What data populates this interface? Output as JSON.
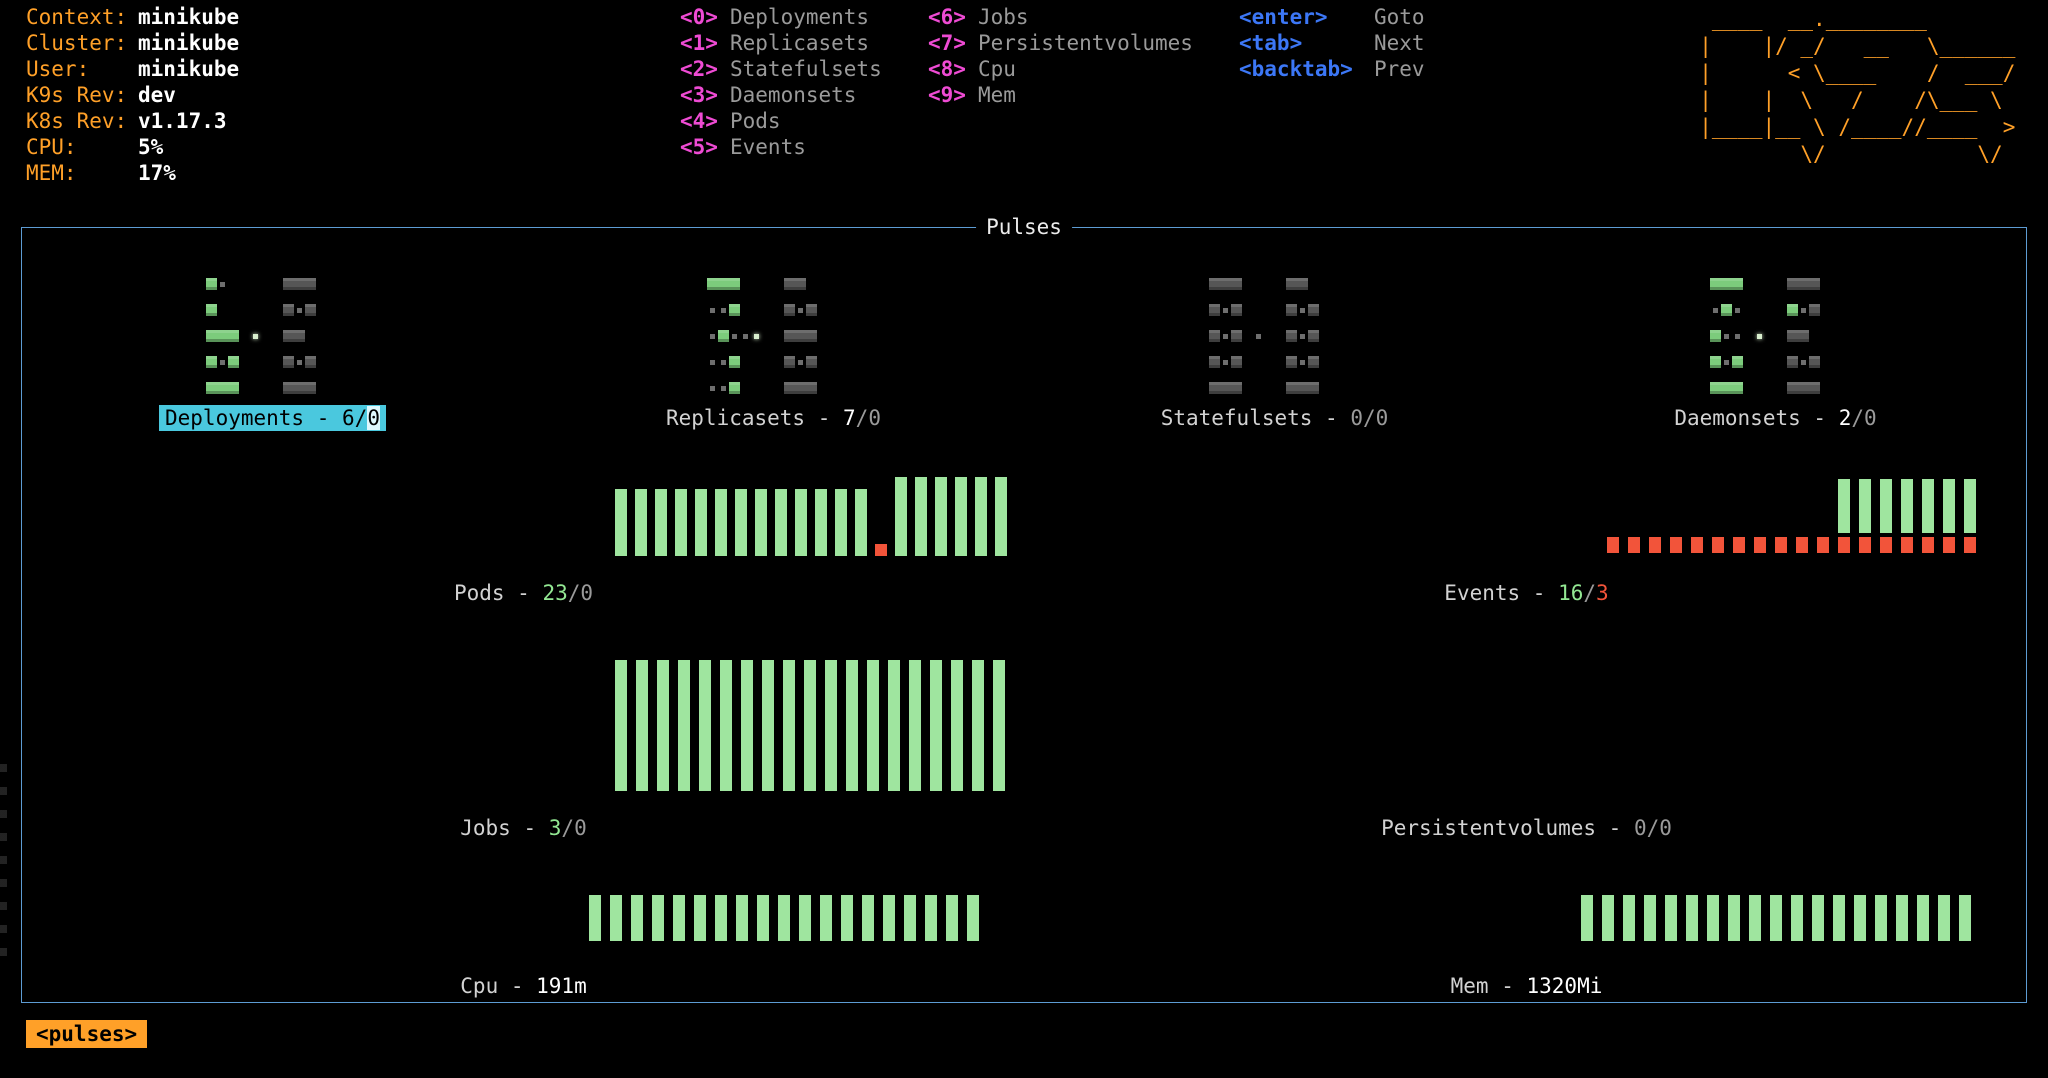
{
  "header": {
    "rows": [
      {
        "label": "Context:",
        "value": "minikube"
      },
      {
        "label": "Cluster:",
        "value": "minikube"
      },
      {
        "label": "User:",
        "value": "minikube"
      },
      {
        "label": "K9s Rev:",
        "value": "dev"
      },
      {
        "label": "K8s Rev:",
        "value": "v1.17.3"
      },
      {
        "label": "CPU:",
        "value": "5%"
      },
      {
        "label": "MEM:",
        "value": "17%"
      }
    ]
  },
  "menu": {
    "col1": [
      {
        "key": "<0>",
        "label": "Deployments"
      },
      {
        "key": "<1>",
        "label": "Replicasets"
      },
      {
        "key": "<2>",
        "label": "Statefulsets"
      },
      {
        "key": "<3>",
        "label": "Daemonsets"
      },
      {
        "key": "<4>",
        "label": "Pods"
      },
      {
        "key": "<5>",
        "label": "Events"
      }
    ],
    "col2": [
      {
        "key": "<6>",
        "label": "Jobs"
      },
      {
        "key": "<7>",
        "label": "Persistentvolumes"
      },
      {
        "key": "<8>",
        "label": "Cpu"
      },
      {
        "key": "<9>",
        "label": "Mem"
      }
    ],
    "col3": [
      {
        "key": "<enter>",
        "label": "Goto"
      },
      {
        "key": "<tab>",
        "label": "Next"
      },
      {
        "key": "<backtab>",
        "label": "Prev"
      }
    ]
  },
  "logo": {
    "lines": [
      " ____  __.________        ",
      "|    |/ _/   __   \\______ ",
      "|      < \\____    /  ___/ ",
      "|    |  \\   /    /\\___ \\  ",
      "|____|__ \\ /____//____  > ",
      "        \\/            \\/  "
    ]
  },
  "pulses": {
    "title": "Pulses",
    "tiles": [
      {
        "id": "deployments",
        "prefix": "Deployments - ",
        "ok": "6",
        "fault": "0",
        "selected": true,
        "pattern": [
          "G.     DDD  ",
          "G      D.D  ",
          "GGG *  DD   ",
          "G.G    D.D  ",
          "GGG    DDD  "
        ]
      },
      {
        "id": "replicasets",
        "prefix": "Replicasets - ",
        "ok": "7",
        "fault": "0",
        "selected": false,
        "pattern": [
          "GGG    DD   ",
          "..G    D.D  ",
          ".G..*  DDD  ",
          "..G    D.D  ",
          "..G    DDD  "
        ]
      },
      {
        "id": "statefulsets",
        "prefix": "Statefulsets - ",
        "ok": "0",
        "fault": "0",
        "selected": false,
        "pattern": [
          "DDD    DD   ",
          "D.D    D.D  ",
          "D.D .  D.D  ",
          "D.D    D.D  ",
          "DDD    DDD  "
        ]
      },
      {
        "id": "daemonsets",
        "prefix": "Daemonsets - ",
        "ok": "2",
        "fault": "0",
        "selected": false,
        "pattern": [
          "GGG    DDD  ",
          ".G.    G.D  ",
          "G.. *  DD   ",
          "G.G    D.D  ",
          "GGG    DDD  "
        ]
      }
    ],
    "charts": [
      {
        "id": "pods",
        "prefix": "Pods - ",
        "ok": "23",
        "fault": "0",
        "bars": [
          "g85",
          "g85",
          "g85",
          "g85",
          "g85",
          "g85",
          "g85",
          "g85",
          "g85",
          "g85",
          "g85",
          "g85",
          "g85",
          "r15",
          "g100",
          "g100",
          "g100",
          "g100",
          "g100",
          "g100"
        ]
      },
      {
        "id": "events",
        "prefix": "Events - ",
        "ok": "16",
        "fault": "3",
        "columns": [
          "d",
          "d",
          "d",
          "d",
          "d",
          "d",
          "d",
          "d",
          "d",
          "d",
          "d",
          "bd",
          "bd",
          "bd",
          "bd",
          "bd",
          "bd",
          "bd"
        ]
      },
      {
        "id": "jobs",
        "prefix": "Jobs - ",
        "ok": "3",
        "fault": "0",
        "bars": [
          "g100",
          "g100",
          "g100",
          "g100",
          "g100",
          "g100",
          "g100",
          "g100",
          "g100",
          "g100",
          "g100",
          "g100",
          "g100",
          "g100",
          "g100",
          "g100",
          "g100",
          "g100",
          "g100"
        ]
      },
      {
        "id": "persistentvolumes",
        "prefix": "Persistentvolumes - ",
        "ok": "0",
        "fault": "0",
        "bars": []
      },
      {
        "id": "cpu",
        "prefix": "Cpu - ",
        "value": "191m",
        "bars": [
          "g100",
          "g100",
          "g100",
          "g100",
          "g100",
          "g100",
          "g100",
          "g100",
          "g100",
          "g100",
          "g100",
          "g100",
          "g100",
          "g100",
          "g100",
          "g100",
          "g100",
          "g100",
          "g100"
        ]
      },
      {
        "id": "mem",
        "prefix": "Mem - ",
        "value": "1320Mi",
        "bars": [
          "g100",
          "g100",
          "g100",
          "g100",
          "g100",
          "g100",
          "g100",
          "g100",
          "g100",
          "g100",
          "g100",
          "g100",
          "g100",
          "g100",
          "g100",
          "g100",
          "g100",
          "g100",
          "g100"
        ]
      }
    ]
  },
  "crumbs": [
    "<pulses>"
  ],
  "colors": {
    "accent_orange": "#ffa028",
    "hotkey_magenta": "#ef4bd4",
    "hotkey_blue": "#3c77f6",
    "selection_cyan": "#4ac8de",
    "ok_green": "#9fe59f",
    "fault_red": "#f2543a",
    "panel_border_blue": "#5d9cd3"
  },
  "chart_data": [
    {
      "type": "bar",
      "title": "Deployments",
      "ok": 6,
      "fault": 0
    },
    {
      "type": "bar",
      "title": "Replicasets",
      "ok": 7,
      "fault": 0
    },
    {
      "type": "bar",
      "title": "Statefulsets",
      "ok": 0,
      "fault": 0
    },
    {
      "type": "bar",
      "title": "Daemonsets",
      "ok": 2,
      "fault": 0
    },
    {
      "type": "bar",
      "title": "Pods",
      "ok": 23,
      "fault": 0
    },
    {
      "type": "bar",
      "title": "Events",
      "ok": 16,
      "fault": 3
    },
    {
      "type": "bar",
      "title": "Jobs",
      "ok": 3,
      "fault": 0
    },
    {
      "type": "bar",
      "title": "Persistentvolumes",
      "ok": 0,
      "fault": 0
    },
    {
      "type": "bar",
      "title": "Cpu",
      "value": "191m"
    },
    {
      "type": "bar",
      "title": "Mem",
      "value": "1320Mi"
    }
  ]
}
